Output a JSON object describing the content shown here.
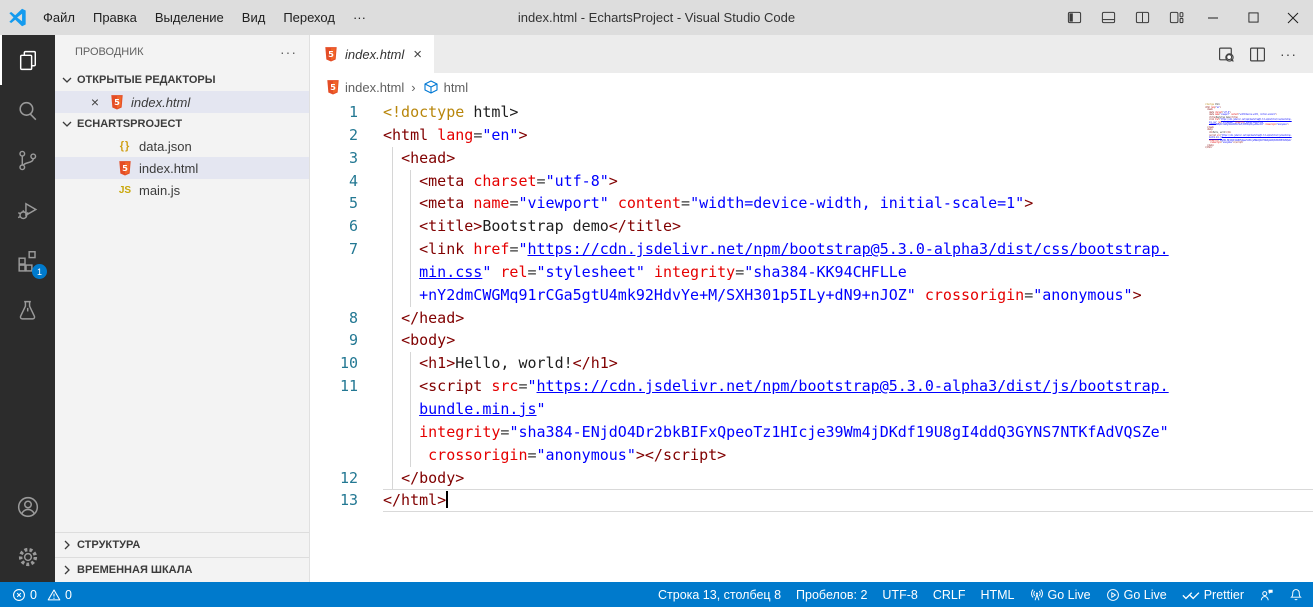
{
  "colors": {
    "title_bar": "#dddddd",
    "activity_bar": "#2c2c2c",
    "sidebar": "#f3f3f3",
    "status_bar": "#007acc",
    "list_selection": "#e4e6f1",
    "badge": "#007acc",
    "html5_icon": "#e44d26",
    "syntax_tag": "#800000",
    "syntax_attribute": "#e50000",
    "syntax_string": "#0000ff",
    "syntax_doctype": "#b8860b",
    "line_number": "#237893"
  },
  "title_bar": {
    "title": "index.html - EchartsProject - Visual Studio Code",
    "menus": [
      "Файл",
      "Правка",
      "Выделение",
      "Вид",
      "Переход",
      "···"
    ]
  },
  "activity_bar": {
    "extensions_badge": "1"
  },
  "sidebar": {
    "header": "ПРОВОДНИК",
    "header_actions": "···",
    "open_editors": {
      "label": "ОТКРЫТЫЕ РЕДАКТОРЫ",
      "items": [
        {
          "icon": "html5",
          "label": "index.html",
          "italic": true,
          "selected": true,
          "close": "×"
        }
      ]
    },
    "project": {
      "label": "ECHARTSPROJECT",
      "items": [
        {
          "icon": "json",
          "label": "data.json"
        },
        {
          "icon": "html5",
          "label": "index.html",
          "selected": true
        },
        {
          "icon": "js",
          "label": "main.js"
        }
      ]
    },
    "outline_label": "СТРУКТУРА",
    "timeline_label": "ВРЕМЕННАЯ ШКАЛА"
  },
  "editor": {
    "tab": {
      "label": "index.html",
      "close": "×"
    },
    "breadcrumb": {
      "file": "index.html",
      "symbol": "html"
    },
    "rows": [
      {
        "n": "1",
        "g": 0,
        "s": [
          [
            "dt",
            "<!doctype "
          ],
          [
            "tx",
            "html>"
          ]
        ]
      },
      {
        "n": "2",
        "g": 0,
        "s": [
          [
            "tg",
            "<html"
          ],
          [
            "df",
            " "
          ],
          [
            "at",
            "lang"
          ],
          [
            "df",
            "="
          ],
          [
            "st",
            "\"en\""
          ],
          [
            "tg",
            ">"
          ]
        ]
      },
      {
        "n": "3",
        "g": 1,
        "s": [
          [
            "df",
            "  "
          ],
          [
            "tg",
            "<head>"
          ]
        ]
      },
      {
        "n": "4",
        "g": 2,
        "s": [
          [
            "df",
            "    "
          ],
          [
            "tg",
            "<meta"
          ],
          [
            "df",
            " "
          ],
          [
            "at",
            "charset"
          ],
          [
            "df",
            "="
          ],
          [
            "st",
            "\"utf-8\""
          ],
          [
            "tg",
            ">"
          ]
        ]
      },
      {
        "n": "5",
        "g": 2,
        "s": [
          [
            "df",
            "    "
          ],
          [
            "tg",
            "<meta"
          ],
          [
            "df",
            " "
          ],
          [
            "at",
            "name"
          ],
          [
            "df",
            "="
          ],
          [
            "st",
            "\"viewport\""
          ],
          [
            "df",
            " "
          ],
          [
            "at",
            "content"
          ],
          [
            "df",
            "="
          ],
          [
            "st",
            "\"width=device-width, initial-scale=1\""
          ],
          [
            "tg",
            ">"
          ]
        ]
      },
      {
        "n": "6",
        "g": 2,
        "s": [
          [
            "df",
            "    "
          ],
          [
            "tg",
            "<title>"
          ],
          [
            "tx",
            "Bootstrap demo"
          ],
          [
            "tg",
            "</title>"
          ]
        ]
      },
      {
        "n": "7",
        "g": 2,
        "s": [
          [
            "df",
            "    "
          ],
          [
            "tg",
            "<link"
          ],
          [
            "df",
            " "
          ],
          [
            "at",
            "href"
          ],
          [
            "df",
            "="
          ],
          [
            "st",
            "\""
          ],
          [
            "lk",
            "https://cdn.jsdelivr.net/npm/bootstrap@5.3.0-alpha3/dist/css/bootstrap."
          ]
        ]
      },
      {
        "n": "",
        "g": 2,
        "s": [
          [
            "df",
            "    "
          ],
          [
            "lk",
            "min.css"
          ],
          [
            "st",
            "\""
          ],
          [
            "df",
            " "
          ],
          [
            "at",
            "rel"
          ],
          [
            "df",
            "="
          ],
          [
            "st",
            "\"stylesheet\""
          ],
          [
            "df",
            " "
          ],
          [
            "at",
            "integrity"
          ],
          [
            "df",
            "="
          ],
          [
            "st",
            "\"sha384-KK94CHFLLe"
          ]
        ]
      },
      {
        "n": "",
        "g": 2,
        "s": [
          [
            "df",
            "    "
          ],
          [
            "st",
            "+nY2dmCWGMq91rCGa5gtU4mk92HdvYe+M/SXH301p5ILy+dN9+nJOZ\""
          ],
          [
            "df",
            " "
          ],
          [
            "at",
            "crossorigin"
          ],
          [
            "df",
            "="
          ],
          [
            "st",
            "\"anonymous\""
          ],
          [
            "tg",
            ">"
          ]
        ]
      },
      {
        "n": "8",
        "g": 1,
        "s": [
          [
            "df",
            "  "
          ],
          [
            "tg",
            "</head>"
          ]
        ]
      },
      {
        "n": "9",
        "g": 1,
        "s": [
          [
            "df",
            "  "
          ],
          [
            "tg",
            "<body>"
          ]
        ]
      },
      {
        "n": "10",
        "g": 2,
        "s": [
          [
            "df",
            "    "
          ],
          [
            "tg",
            "<h1>"
          ],
          [
            "tx",
            "Hello, world!"
          ],
          [
            "tg",
            "</h1>"
          ]
        ]
      },
      {
        "n": "11",
        "g": 2,
        "s": [
          [
            "df",
            "    "
          ],
          [
            "tg",
            "<script"
          ],
          [
            "df",
            " "
          ],
          [
            "at",
            "src"
          ],
          [
            "df",
            "="
          ],
          [
            "st",
            "\""
          ],
          [
            "lk",
            "https://cdn.jsdelivr.net/npm/bootstrap@5.3.0-alpha3/dist/js/bootstrap."
          ]
        ]
      },
      {
        "n": "",
        "g": 2,
        "s": [
          [
            "df",
            "    "
          ],
          [
            "lk",
            "bundle.min.js"
          ],
          [
            "st",
            "\""
          ]
        ]
      },
      {
        "n": "",
        "g": 2,
        "s": [
          [
            "df",
            "    "
          ],
          [
            "at",
            "integrity"
          ],
          [
            "df",
            "="
          ],
          [
            "st",
            "\"sha384-ENjdO4Dr2bkBIFxQpeoTz1HIcje39Wm4jDKdf19U8gI4ddQ3GYNS7NTKfAdVQSZe\""
          ]
        ]
      },
      {
        "n": "",
        "g": 2,
        "s": [
          [
            "df",
            "     "
          ],
          [
            "at",
            "crossorigin"
          ],
          [
            "df",
            "="
          ],
          [
            "st",
            "\"anonymous\""
          ],
          [
            "tg",
            "></script>"
          ]
        ]
      },
      {
        "n": "12",
        "g": 1,
        "s": [
          [
            "df",
            "  "
          ],
          [
            "tg",
            "</body>"
          ]
        ]
      },
      {
        "n": "13",
        "g": 0,
        "cur": true,
        "cursor": true,
        "s": [
          [
            "tg",
            "</html>"
          ]
        ]
      }
    ]
  },
  "status_bar": {
    "left": [
      {
        "icon": "error",
        "label": "0"
      },
      {
        "icon": "warning",
        "label": "0"
      }
    ],
    "right": [
      {
        "label": "Строка 13, столбец 8"
      },
      {
        "label": "Пробелов: 2"
      },
      {
        "label": "UTF-8"
      },
      {
        "label": "CRLF"
      },
      {
        "label": "HTML"
      },
      {
        "icon": "broadcast",
        "label": "Go Live"
      },
      {
        "icon": "run",
        "label": "Go Live"
      },
      {
        "icon": "checks",
        "label": "Prettier"
      },
      {
        "icon": "feedback",
        "label": ""
      },
      {
        "icon": "bell",
        "label": ""
      }
    ]
  }
}
